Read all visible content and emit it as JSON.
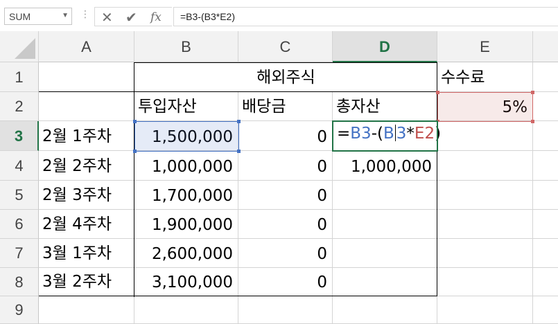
{
  "name_box": {
    "value": "SUM"
  },
  "formula_bar": {
    "cancel_icon": "✕",
    "enter_icon": "✔",
    "function_icon": "fx",
    "formula": "=B3-(B3*E2)"
  },
  "columns": [
    "A",
    "B",
    "C",
    "D",
    "E"
  ],
  "active_column": "D",
  "rows": [
    "1",
    "2",
    "3",
    "4",
    "5",
    "6",
    "7",
    "8",
    "9"
  ],
  "active_row": "3",
  "header": {
    "merged_title": "해외주식",
    "e1": "수수료",
    "b2": "투입자산",
    "c2": "배당금",
    "d2": "총자산",
    "e2": "5%"
  },
  "data_rows": [
    {
      "label": "2월 1주차",
      "invest": "1,500,000",
      "dividend": "0",
      "total": ""
    },
    {
      "label": "2월 2주차",
      "invest": "1,000,000",
      "dividend": "0",
      "total": "1,000,000"
    },
    {
      "label": "2월 3주차",
      "invest": "1,700,000",
      "dividend": "0",
      "total": ""
    },
    {
      "label": "2월 4주차",
      "invest": "1,900,000",
      "dividend": "0",
      "total": ""
    },
    {
      "label": "3월 1주차",
      "invest": "2,600,000",
      "dividend": "0",
      "total": ""
    },
    {
      "label": "3월 2주차",
      "invest": "3,100,000",
      "dividend": "0",
      "total": ""
    }
  ],
  "editing_cell": {
    "address": "D3",
    "parts": [
      "=",
      "B3",
      "-(",
      "B",
      "3",
      "*",
      "E2",
      ")"
    ]
  },
  "colors": {
    "accent": "#217346",
    "ref_b3": "#4472c4",
    "ref_e2": "#c0504d"
  }
}
